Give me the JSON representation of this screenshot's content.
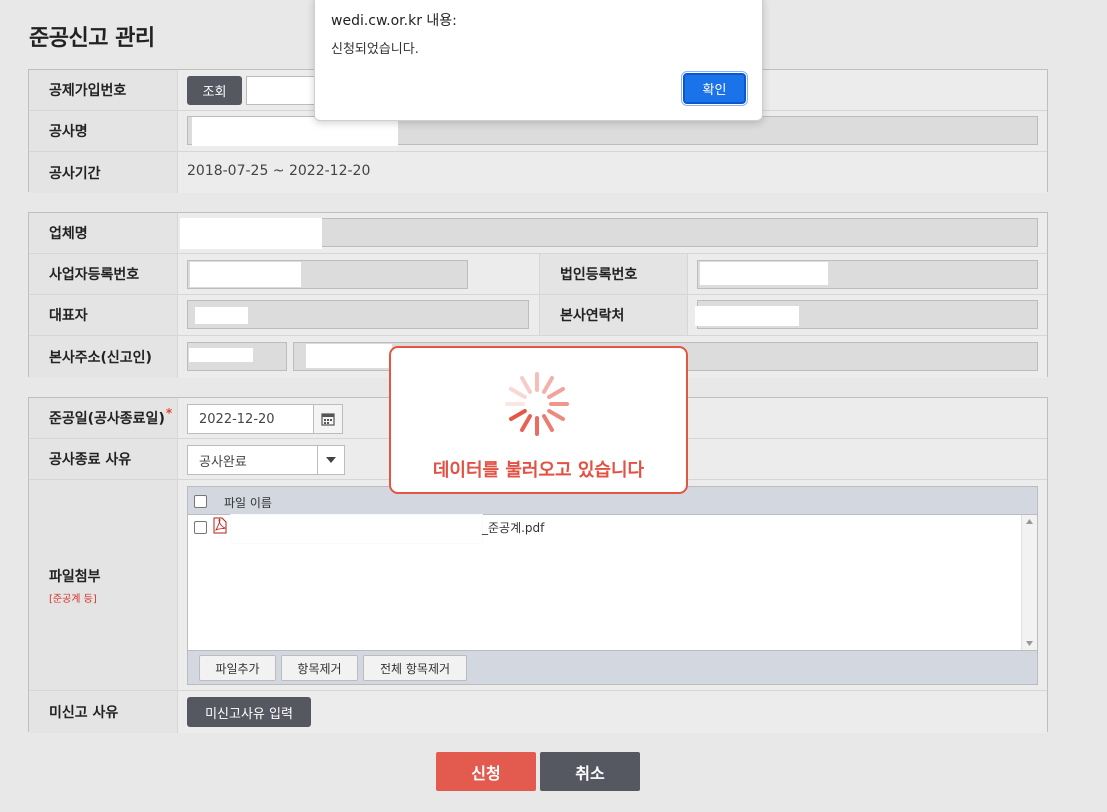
{
  "page": {
    "title": "준공신고 관리"
  },
  "section1": {
    "deduction_no_label": "공제가입번호",
    "lookup_button": "조회",
    "project_name_label": "공사명",
    "period_label": "공사기간",
    "period_value": "2018-07-25 ~ 2022-12-20"
  },
  "section2": {
    "company_label": "업체명",
    "biz_reg_label": "사업자등록번호",
    "corp_reg_label": "법인등록번호",
    "ceo_label": "대표자",
    "hq_phone_label": "본사연락처",
    "hq_address_label": "본사주소(신고인)"
  },
  "section3": {
    "completion_date_label": "준공일(공사종료일)",
    "required_mark": "*",
    "completion_date_value": "2022-12-20",
    "end_reason_label": "공사종료 사유",
    "end_reason_value": "공사완료",
    "attachment_label": "파일첨부",
    "attachment_note": "[준공계 등]",
    "file_col_header": "파일 이름",
    "file_name_suffix": "_준공계.pdf",
    "add_file_button": "파일추가",
    "remove_item_button": "항목제거",
    "remove_all_button": "전체 항목제거",
    "unreported_label": "미신고 사유",
    "unreported_button": "미신고사유 입력"
  },
  "actions": {
    "submit": "신청",
    "cancel": "취소"
  },
  "alert": {
    "title": "wedi.cw.or.kr 내용:",
    "message": "신청되었습니다.",
    "ok": "확인"
  },
  "loading": {
    "message": "데이터를 불러오고 있습니다"
  },
  "colors": {
    "submit": "#e35a4f",
    "cancel": "#555761",
    "loading_accent": "#e65444",
    "dialog_ok": "#1a73e8"
  }
}
